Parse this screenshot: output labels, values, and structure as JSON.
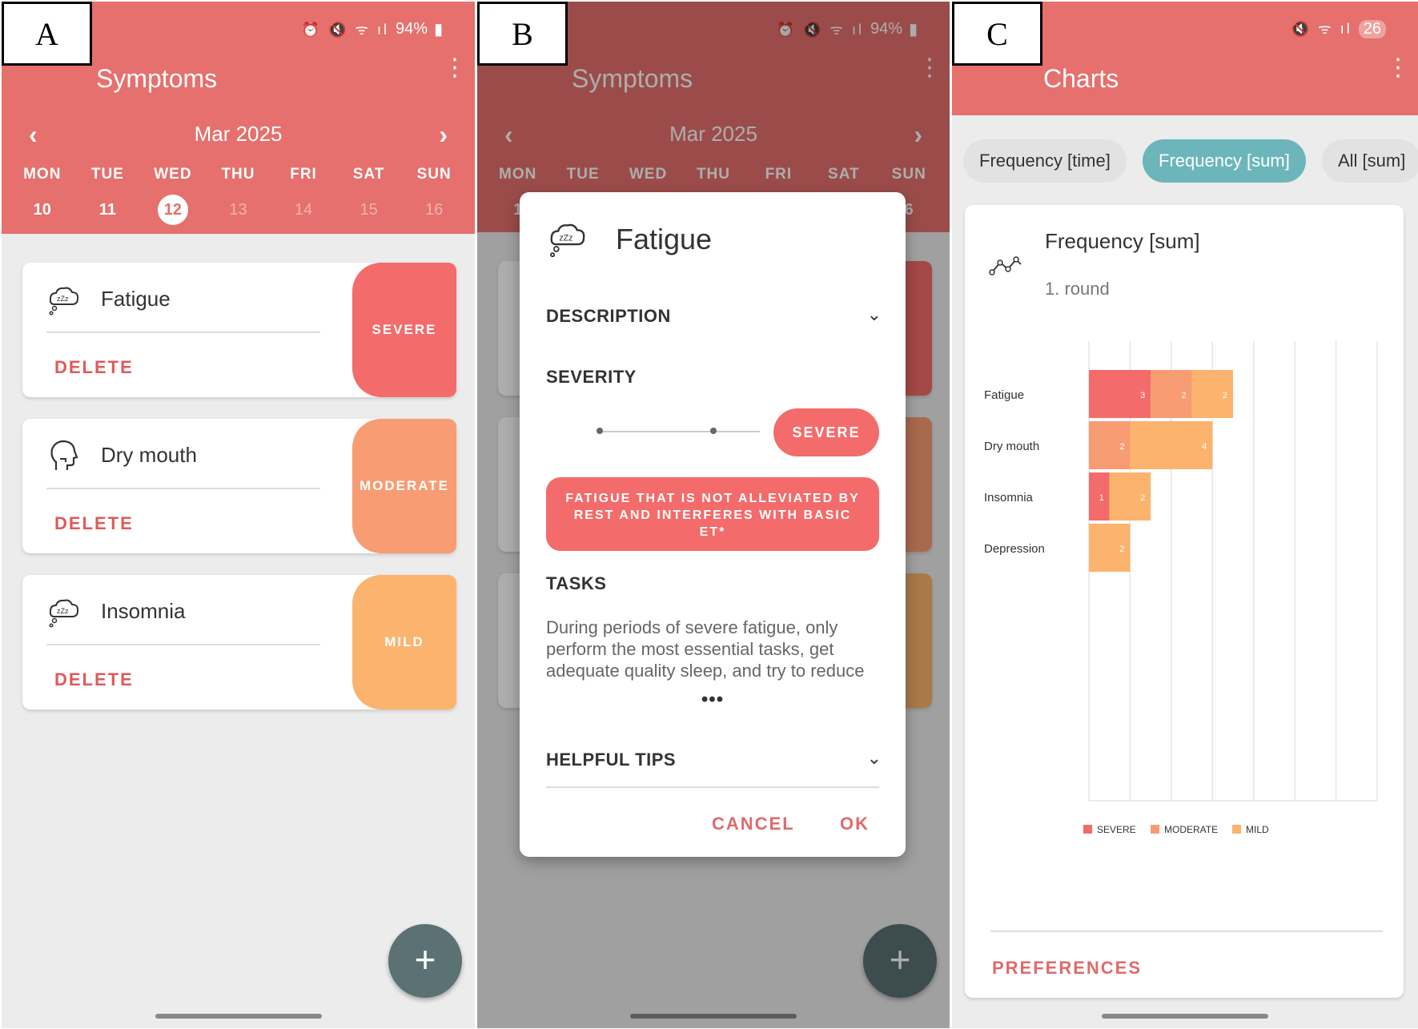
{
  "panels": {
    "a": {
      "label": "A",
      "status": {
        "icons": "⏰ 🔇 ᯤ ıl",
        "battery": "94%"
      },
      "title": "Symptoms",
      "calendar": {
        "month": "Mar 2025",
        "days": [
          {
            "name": "MON",
            "date": "10"
          },
          {
            "name": "TUE",
            "date": "11"
          },
          {
            "name": "WED",
            "date": "12"
          },
          {
            "name": "THU",
            "date": "13"
          },
          {
            "name": "FRI",
            "date": "14"
          },
          {
            "name": "SAT",
            "date": "15"
          },
          {
            "name": "SUN",
            "date": "16"
          }
        ],
        "selected": "12"
      },
      "symptoms": [
        {
          "name": "Fatigue",
          "delete": "DELETE",
          "severity": "SEVERE",
          "icon": "sleep-cloud-icon"
        },
        {
          "name": "Dry mouth",
          "delete": "DELETE",
          "severity": "MODERATE",
          "icon": "head-profile-icon"
        },
        {
          "name": "Insomnia",
          "delete": "DELETE",
          "severity": "MILD",
          "icon": "sleep-cloud-icon"
        }
      ],
      "fab": "+"
    },
    "b": {
      "label": "B",
      "status": {
        "icons": "⏰ 🔇 ᯤ ıl",
        "battery": "94%"
      },
      "title": "Symptoms",
      "calendar": {
        "month": "Mar 2025",
        "days": [
          {
            "name": "MON",
            "date": "1"
          },
          {
            "name": "TUE",
            "date": ""
          },
          {
            "name": "WED",
            "date": ""
          },
          {
            "name": "THU",
            "date": ""
          },
          {
            "name": "FRI",
            "date": ""
          },
          {
            "name": "SAT",
            "date": ""
          },
          {
            "name": "SUN",
            "date": "6"
          }
        ]
      },
      "fab": "+",
      "dialog": {
        "title": "Fatigue",
        "description_label": "DESCRIPTION",
        "severity_label": "SEVERITY",
        "severity_value": "SEVERE",
        "severity_description": "FATIGUE THAT IS NOT ALLEVIATED BY REST AND INTERFERES WITH BASIC ET*",
        "tasks_label": "TASKS",
        "tasks_text": "During periods of severe fatigue, only perform the most essential tasks, get adequate quality sleep, and try to reduce",
        "more": "•••",
        "tips_label": "HELPFUL TIPS",
        "cancel": "CANCEL",
        "ok": "OK"
      }
    },
    "c": {
      "label": "C",
      "status": {
        "icons": "🔇 ᯤ ıl",
        "battery": "26"
      },
      "title": "Charts",
      "chips": [
        "Frequency [time]",
        "Frequency [sum]",
        "All [sum]"
      ],
      "active_chip": "Frequency [sum]",
      "card_title": "Frequency [sum]",
      "card_subtitle": "1. round",
      "preferences": "PREFERENCES"
    }
  },
  "colors": {
    "header": "#e5706d",
    "severe": "#f36b6b",
    "moderate": "#f89c73",
    "mild": "#fbb36d",
    "teal": "#6cb6bb",
    "fab": "#5b7173"
  },
  "chart_data": {
    "type": "bar",
    "orientation": "horizontal",
    "stacked": true,
    "categories": [
      "Fatigue",
      "Dry mouth",
      "Insomnia",
      "Depression"
    ],
    "series": [
      {
        "name": "SEVERE",
        "values": [
          3,
          0,
          1,
          0
        ],
        "color": "#f36b6b"
      },
      {
        "name": "MODERATE",
        "values": [
          2,
          2,
          0,
          0
        ],
        "color": "#f89c73"
      },
      {
        "name": "MILD",
        "values": [
          2,
          4,
          2,
          2
        ],
        "color": "#fbb36d"
      }
    ],
    "xlim": [
      0,
      14
    ],
    "grid": true,
    "legend": "bottom"
  }
}
